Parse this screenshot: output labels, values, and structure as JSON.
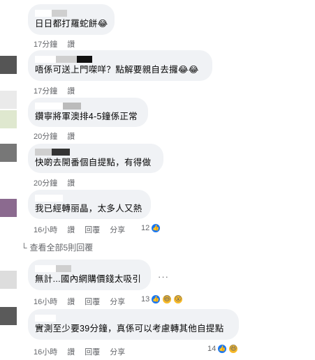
{
  "comments": [
    {
      "text": "日日都打羅蛇餅",
      "emoji": "😂",
      "time": "17分鐘",
      "reply": "讚",
      "extra": []
    },
    {
      "text": "唔係可送上門㗎咩？點解要親自去攞",
      "emoji": "😂😂",
      "time": "17分鐘",
      "reply": "讚",
      "extra": []
    },
    {
      "text": "鑽寧將軍澳排4-5鐘係正常",
      "emoji": "",
      "time": "20分鐘",
      "reply": "讚",
      "extra": []
    },
    {
      "text": "快啲去開番個自提點，有得做",
      "emoji": "",
      "time": "20分鐘",
      "reply": "讚",
      "extra": []
    },
    {
      "text": "我已經轉丽晶，太多人又熱",
      "emoji": "",
      "time": "16小時",
      "reply": "讚",
      "extra": [
        "回覆",
        "分享"
      ],
      "count": "12"
    },
    {
      "text": "無計...國內網購價錢太吸引",
      "emoji": "",
      "time": "16小時",
      "reply": "讚",
      "extra": [
        "回覆",
        "分享"
      ],
      "count": "13"
    },
    {
      "text": "實測至少要39分鐘，真係可以考慮轉其他自提點",
      "emoji": "",
      "time": "16小時",
      "reply": "讚",
      "extra": [
        "回覆",
        "分享"
      ],
      "count": "14"
    }
  ],
  "view_more": "查看全部5則回覆",
  "more_options": "···",
  "colors": {
    "bubble": "#f0f2f5",
    "meta": "#65676b",
    "like": "#1877f2"
  }
}
